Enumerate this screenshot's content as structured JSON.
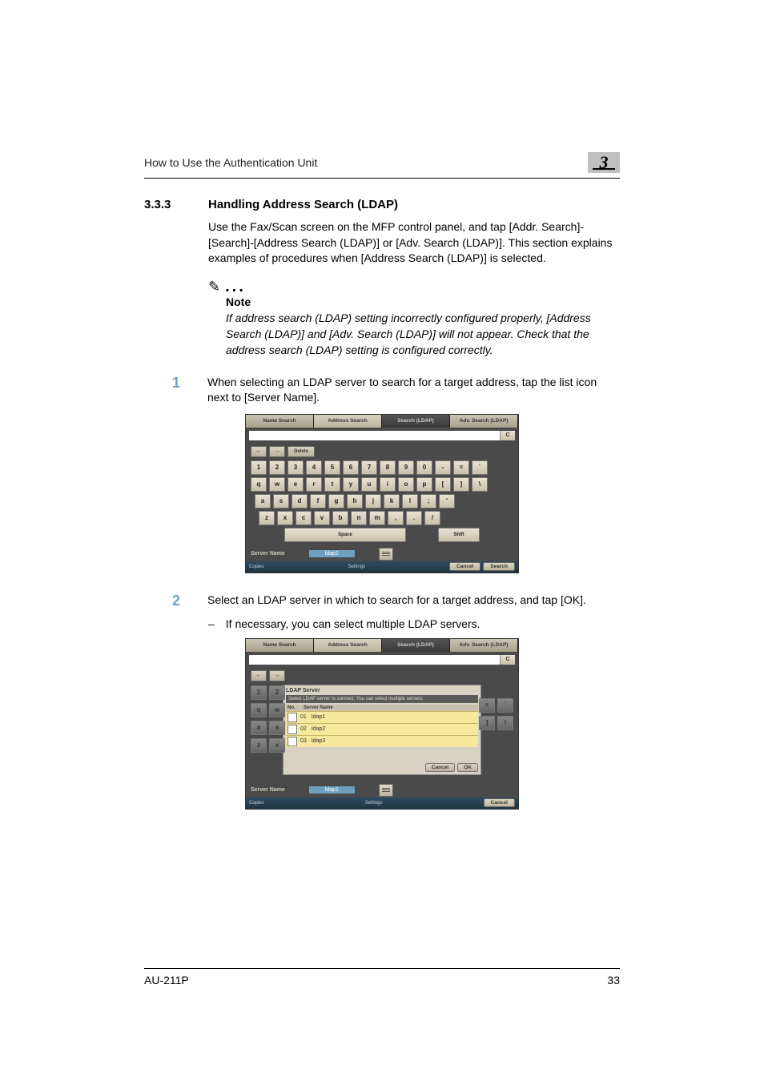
{
  "header": {
    "running_title": "How to Use the Authentication Unit",
    "chapter_number": "3"
  },
  "section": {
    "number": "3.3.3",
    "title": "Handling Address Search (LDAP)",
    "intro": "Use the Fax/Scan screen on the MFP control panel, and tap [Addr. Search]-[Search]-[Address Search (LDAP)] or [Adv. Search (LDAP)]. This section explains examples of procedures when [Address Search (LDAP)] is selected."
  },
  "note": {
    "label": "Note",
    "text": "If address search (LDAP) setting incorrectly configured properly, [Address Search (LDAP)] and [Adv. Search (LDAP)] will not appear. Check that the address search (LDAP) setting is configured correctly."
  },
  "steps": [
    {
      "n": "1",
      "text": "When selecting an LDAP server to search for a target address, tap the list icon next to [Server Name]."
    },
    {
      "n": "2",
      "text": "Select an LDAP server in which to search for a target address, and tap [OK].",
      "bullet": "If necessary, you can select multiple LDAP servers."
    }
  ],
  "screenshot1": {
    "tabs": [
      "Name Search",
      "Address Search",
      "Search (LDAP)",
      "Adv. Search (LDAP)"
    ],
    "clear": "C",
    "nav": {
      "back": "←",
      "fwd": "→",
      "delete": "Delete"
    },
    "kb": {
      "r1": [
        "1",
        "2",
        "3",
        "4",
        "5",
        "6",
        "7",
        "8",
        "9",
        "0",
        "-",
        "=",
        "`"
      ],
      "r2": [
        "q",
        "w",
        "e",
        "r",
        "t",
        "y",
        "u",
        "i",
        "o",
        "p",
        "[",
        "]",
        "\\"
      ],
      "r3": [
        "a",
        "s",
        "d",
        "f",
        "g",
        "h",
        "j",
        "k",
        "l",
        ";",
        "'"
      ],
      "r4": [
        "z",
        "x",
        "c",
        "v",
        "b",
        "n",
        "m",
        ",",
        ".",
        "/"
      ],
      "space": "Space",
      "shift": "Shift"
    },
    "server_label": "Server Name",
    "server_value": "ldap1",
    "footer_left": "Copies",
    "footer_settings": "Settings",
    "footer_btns": [
      "Cancel",
      "Search"
    ]
  },
  "screenshot2": {
    "tabs": [
      "Name Search",
      "Address Search",
      "Search (LDAP)",
      "Adv. Search (LDAP)"
    ],
    "clear": "C",
    "nav": {
      "back": "←",
      "fwd": "→"
    },
    "left_keys": [
      [
        "1",
        "2"
      ],
      [
        "q",
        "w"
      ],
      [
        "a",
        "s"
      ],
      [
        "z",
        "x"
      ]
    ],
    "right_keys": [
      [
        "=",
        "`"
      ],
      [
        "]",
        "\\"
      ]
    ],
    "dialog": {
      "title": "LDAP Server",
      "subtitle": "Select LDAP server to connect. You can select multiple servers.",
      "header_no": "No.",
      "header_name": "Server Name",
      "rows": [
        {
          "no": "01",
          "name": "ldap1"
        },
        {
          "no": "02",
          "name": "ldap2"
        },
        {
          "no": "03",
          "name": "ldap3"
        }
      ],
      "btns": [
        "Cancel",
        "OK"
      ]
    },
    "server_label": "Server Name",
    "server_value": "ldap1",
    "footer_left": "Copies",
    "footer_settings": "Settings",
    "footer_btn": "Cancel"
  },
  "footer": {
    "model": "AU-211P",
    "page": "33"
  }
}
